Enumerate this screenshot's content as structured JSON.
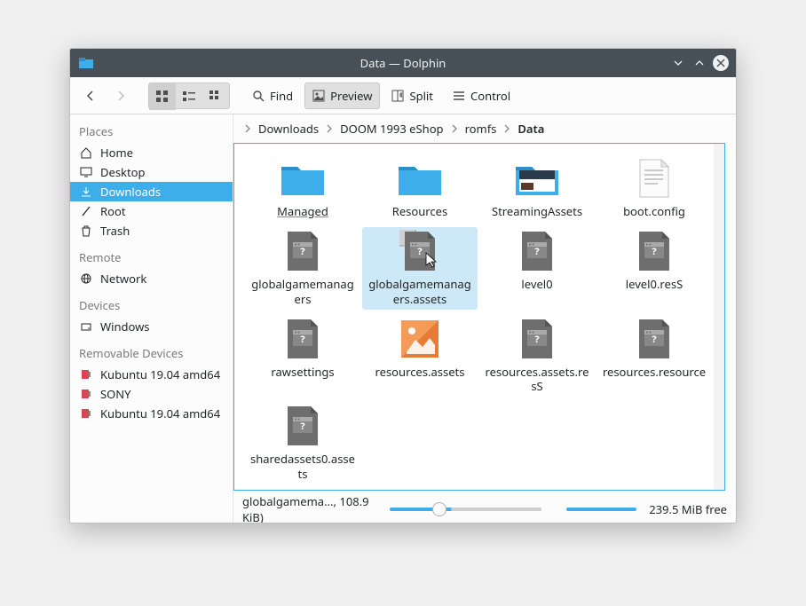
{
  "window": {
    "title": "Data — Dolphin"
  },
  "toolbar": {
    "find": "Find",
    "preview": "Preview",
    "split": "Split",
    "control": "Control"
  },
  "breadcrumb": {
    "items": [
      "Downloads",
      "DOOM 1993 eShop",
      "romfs",
      "Data"
    ],
    "current_index": 3
  },
  "sidebar": {
    "sections": [
      {
        "title": "Places",
        "items": [
          {
            "label": "Home",
            "icon": "home"
          },
          {
            "label": "Desktop",
            "icon": "desktop"
          },
          {
            "label": "Downloads",
            "icon": "download",
            "selected": true
          },
          {
            "label": "Root",
            "icon": "root"
          },
          {
            "label": "Trash",
            "icon": "trash"
          }
        ]
      },
      {
        "title": "Remote",
        "items": [
          {
            "label": "Network",
            "icon": "network"
          }
        ]
      },
      {
        "title": "Devices",
        "items": [
          {
            "label": "Windows",
            "icon": "drive"
          }
        ]
      },
      {
        "title": "Removable Devices",
        "items": [
          {
            "label": "Kubuntu 19.04 amd64",
            "icon": "removable"
          },
          {
            "label": "SONY",
            "icon": "removable"
          },
          {
            "label": "Kubuntu 19.04 amd64",
            "icon": "removable"
          }
        ]
      }
    ]
  },
  "files": [
    {
      "name": "Managed",
      "type": "folder",
      "underline": true
    },
    {
      "name": "Resources",
      "type": "folder"
    },
    {
      "name": "StreamingAssets",
      "type": "folder-thumb"
    },
    {
      "name": "boot.config",
      "type": "text"
    },
    {
      "name": "globalgamemanagers",
      "type": "unknown"
    },
    {
      "name": "globalgamemanagers.assets",
      "type": "unknown-cursor",
      "selected": true
    },
    {
      "name": "level0",
      "type": "unknown"
    },
    {
      "name": "level0.resS",
      "type": "unknown"
    },
    {
      "name": "rawsettings",
      "type": "unknown"
    },
    {
      "name": "resources.assets",
      "type": "image"
    },
    {
      "name": "resources.assets.resS",
      "type": "unknown"
    },
    {
      "name": "resources.resource",
      "type": "unknown"
    },
    {
      "name": "sharedassets0.assets",
      "type": "unknown"
    }
  ],
  "status": {
    "selection": "globalgamema..., 108.9 KiB)",
    "free": "239.5 MiB free"
  },
  "colors": {
    "accent": "#3daee9",
    "titlebar": "#475057",
    "folder": "#3daee9"
  }
}
